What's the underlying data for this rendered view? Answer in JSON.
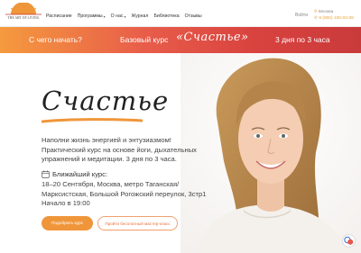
{
  "header": {
    "logo_text": "THE ART OF LIVING",
    "nav": [
      {
        "label": "Расписание",
        "has_caret": false
      },
      {
        "label": "Программы",
        "has_caret": true
      },
      {
        "label": "О нас",
        "has_caret": true
      },
      {
        "label": "Журнал",
        "has_caret": false
      },
      {
        "label": "Библиотека",
        "has_caret": false
      },
      {
        "label": "Отзывы",
        "has_caret": false
      }
    ],
    "login_label": "Войти",
    "city": "Москва",
    "phone": "8 (800) 100-03-09"
  },
  "banner": {
    "where": "С чего начать?",
    "course": "Базовый курс",
    "name": "«Счастье»",
    "duration": "3 дня по 3 часа"
  },
  "hero": {
    "title": "Счастье",
    "description": "Наполни жизнь энергией и энтузиазмом! Практический курс на основе йоги, дыхательных упражнений и медитации. 3 дня по 3 часа.",
    "next_course": {
      "label": "Ближайший курс:",
      "line1": "18–20 Сентября, Москва, метро Таганская/",
      "line2": "Марксистская, Большой Рогожский переулок, 3стр1",
      "line3": "Начало в 19:00"
    },
    "primary_button": "Подобрать курс",
    "secondary_button": "Пройти бесплатный мастер-класс"
  },
  "colors": {
    "accent": "#f0963a",
    "banner_start": "#f59a3e",
    "banner_end": "#c93a3b"
  }
}
